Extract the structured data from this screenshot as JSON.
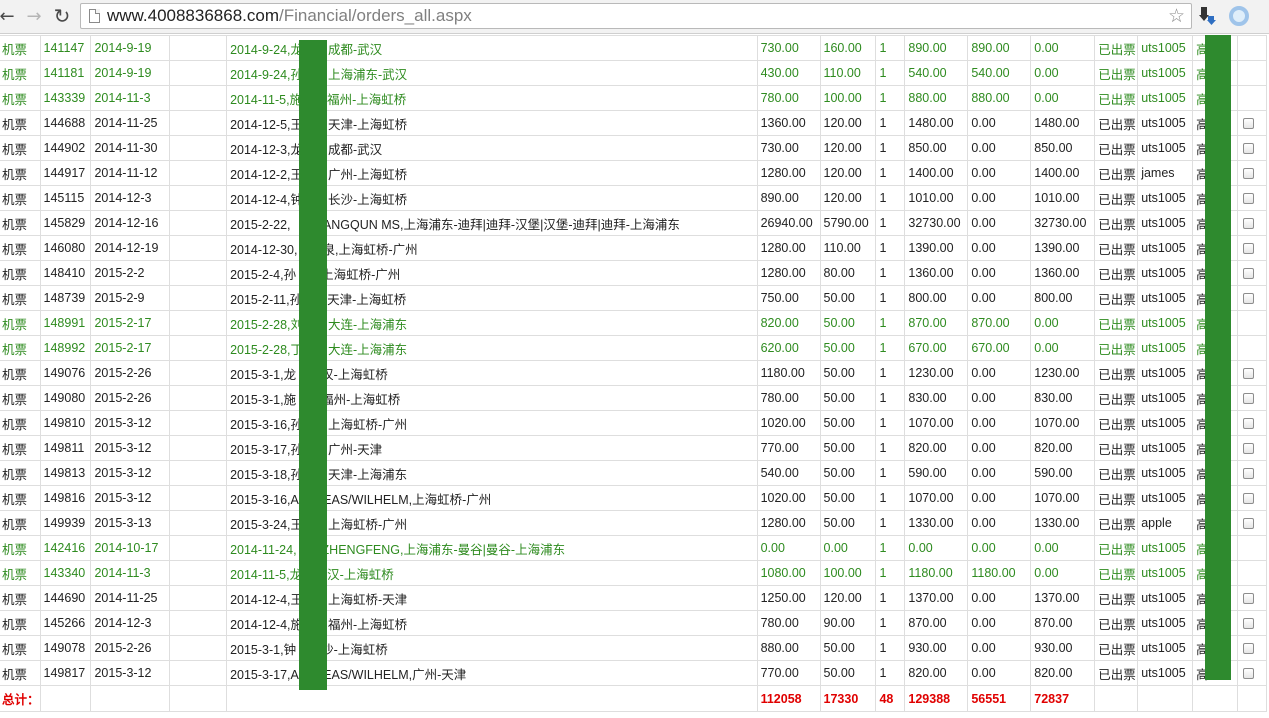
{
  "browser": {
    "url_host": "www.4008836868.com",
    "url_path": "/Financial/orders_all.aspx",
    "back_icon": "back-arrow-icon",
    "forward_icon": "forward-arrow-icon",
    "reload_icon": "reload-icon",
    "bookmark_icon": "star-icon"
  },
  "colors": {
    "issued_green": "#2e8b1f",
    "totals_red": "#e00000",
    "redaction_green": "#2e8a2e"
  },
  "orders": [
    {
      "type": "机票",
      "id": "141147",
      "date": "2014-9-19",
      "detail": "2014-9-24,龙　　成都-武汉",
      "price": "730.00",
      "tax": "160.00",
      "qty": "1",
      "total": "890.00",
      "paid": "890.00",
      "owed": "0.00",
      "status": "已出票",
      "user": "uts1005",
      "tail": "高",
      "green": true,
      "checkbox": false
    },
    {
      "type": "机票",
      "id": "141181",
      "date": "2014-9-19",
      "detail": "2014-9-24,孙　　上海浦东-武汉",
      "price": "430.00",
      "tax": "110.00",
      "qty": "1",
      "total": "540.00",
      "paid": "540.00",
      "owed": "0.00",
      "status": "已出票",
      "user": "uts1005",
      "tail": "高",
      "green": true,
      "checkbox": false
    },
    {
      "type": "机票",
      "id": "143339",
      "date": "2014-11-3",
      "detail": "2014-11-5,施　　福州-上海虹桥",
      "price": "780.00",
      "tax": "100.00",
      "qty": "1",
      "total": "880.00",
      "paid": "880.00",
      "owed": "0.00",
      "status": "已出票",
      "user": "uts1005",
      "tail": "高",
      "green": true,
      "checkbox": false
    },
    {
      "type": "机票",
      "id": "144688",
      "date": "2014-11-25",
      "detail": "2014-12-5,王　　天津-上海虹桥",
      "price": "1360.00",
      "tax": "120.00",
      "qty": "1",
      "total": "1480.00",
      "paid": "0.00",
      "owed": "1480.00",
      "status": "已出票",
      "user": "uts1005",
      "tail": "高",
      "green": false,
      "checkbox": true
    },
    {
      "type": "机票",
      "id": "144902",
      "date": "2014-11-30",
      "detail": "2014-12-3,龙　　成都-武汉",
      "price": "730.00",
      "tax": "120.00",
      "qty": "1",
      "total": "850.00",
      "paid": "0.00",
      "owed": "850.00",
      "status": "已出票",
      "user": "uts1005",
      "tail": "高",
      "green": false,
      "checkbox": true
    },
    {
      "type": "机票",
      "id": "144917",
      "date": "2014-11-12",
      "detail": "2014-12-2,王　　广州-上海虹桥",
      "price": "1280.00",
      "tax": "120.00",
      "qty": "1",
      "total": "1400.00",
      "paid": "0.00",
      "owed": "1400.00",
      "status": "已出票",
      "user": "james",
      "tail": "高",
      "green": false,
      "checkbox": true
    },
    {
      "type": "机票",
      "id": "145115",
      "date": "2014-12-3",
      "detail": "2014-12-4,钟　　长沙-上海虹桥",
      "price": "890.00",
      "tax": "120.00",
      "qty": "1",
      "total": "1010.00",
      "paid": "0.00",
      "owed": "1010.00",
      "status": "已出票",
      "user": "uts1005",
      "tail": "高",
      "green": false,
      "checkbox": true
    },
    {
      "type": "机票",
      "id": "145829",
      "date": "2014-12-16",
      "detail": "2015-2-22,　　YANGQUN MS,上海浦东-迪拜|迪拜-汉堡|汉堡-迪拜|迪拜-上海浦东",
      "price": "26940.00",
      "tax": "5790.00",
      "qty": "1",
      "total": "32730.00",
      "paid": "0.00",
      "owed": "32730.00",
      "status": "已出票",
      "user": "uts1005",
      "tail": "高",
      "green": false,
      "checkbox": true
    },
    {
      "type": "机票",
      "id": "146080",
      "date": "2014-12-19",
      "detail": "2014-12-30,　　泉,上海虹桥-广州",
      "price": "1280.00",
      "tax": "110.00",
      "qty": "1",
      "total": "1390.00",
      "paid": "0.00",
      "owed": "1390.00",
      "status": "已出票",
      "user": "uts1005",
      "tail": "高",
      "green": false,
      "checkbox": true
    },
    {
      "type": "机票",
      "id": "148410",
      "date": "2015-2-2",
      "detail": "2015-2-4,孙　　上海虹桥-广州",
      "price": "1280.00",
      "tax": "80.00",
      "qty": "1",
      "total": "1360.00",
      "paid": "0.00",
      "owed": "1360.00",
      "status": "已出票",
      "user": "uts1005",
      "tail": "高",
      "green": false,
      "checkbox": true
    },
    {
      "type": "机票",
      "id": "148739",
      "date": "2015-2-9",
      "detail": "2015-2-11,孙　　天津-上海虹桥",
      "price": "750.00",
      "tax": "50.00",
      "qty": "1",
      "total": "800.00",
      "paid": "0.00",
      "owed": "800.00",
      "status": "已出票",
      "user": "uts1005",
      "tail": "高",
      "green": false,
      "checkbox": true
    },
    {
      "type": "机票",
      "id": "148991",
      "date": "2015-2-17",
      "detail": "2015-2-28,刘　　大连-上海浦东",
      "price": "820.00",
      "tax": "50.00",
      "qty": "1",
      "total": "870.00",
      "paid": "870.00",
      "owed": "0.00",
      "status": "已出票",
      "user": "uts1005",
      "tail": "高",
      "green": true,
      "checkbox": false
    },
    {
      "type": "机票",
      "id": "148992",
      "date": "2015-2-17",
      "detail": "2015-2-28,丁　　大连-上海浦东",
      "price": "620.00",
      "tax": "50.00",
      "qty": "1",
      "total": "670.00",
      "paid": "670.00",
      "owed": "0.00",
      "status": "已出票",
      "user": "uts1005",
      "tail": "高",
      "green": true,
      "checkbox": false
    },
    {
      "type": "机票",
      "id": "149076",
      "date": "2015-2-26",
      "detail": "2015-3-1,龙　　汉-上海虹桥",
      "price": "1180.00",
      "tax": "50.00",
      "qty": "1",
      "total": "1230.00",
      "paid": "0.00",
      "owed": "1230.00",
      "status": "已出票",
      "user": "uts1005",
      "tail": "高",
      "green": false,
      "checkbox": true
    },
    {
      "type": "机票",
      "id": "149080",
      "date": "2015-2-26",
      "detail": "2015-3-1,施　　福州-上海虹桥",
      "price": "780.00",
      "tax": "50.00",
      "qty": "1",
      "total": "830.00",
      "paid": "0.00",
      "owed": "830.00",
      "status": "已出票",
      "user": "uts1005",
      "tail": "高",
      "green": false,
      "checkbox": true
    },
    {
      "type": "机票",
      "id": "149810",
      "date": "2015-3-12",
      "detail": "2015-3-16,孙　　上海虹桥-广州",
      "price": "1020.00",
      "tax": "50.00",
      "qty": "1",
      "total": "1070.00",
      "paid": "0.00",
      "owed": "1070.00",
      "status": "已出票",
      "user": "uts1005",
      "tail": "高",
      "green": false,
      "checkbox": true
    },
    {
      "type": "机票",
      "id": "149811",
      "date": "2015-3-12",
      "detail": "2015-3-17,孙　　广州-天津",
      "price": "770.00",
      "tax": "50.00",
      "qty": "1",
      "total": "820.00",
      "paid": "0.00",
      "owed": "820.00",
      "status": "已出票",
      "user": "uts1005",
      "tail": "高",
      "green": false,
      "checkbox": true
    },
    {
      "type": "机票",
      "id": "149813",
      "date": "2015-3-12",
      "detail": "2015-3-18,孙　　天津-上海浦东",
      "price": "540.00",
      "tax": "50.00",
      "qty": "1",
      "total": "590.00",
      "paid": "0.00",
      "owed": "590.00",
      "status": "已出票",
      "user": "uts1005",
      "tail": "高",
      "green": false,
      "checkbox": true
    },
    {
      "type": "机票",
      "id": "149816",
      "date": "2015-3-12",
      "detail": "2015-3-16,A　　EAS/WILHELM,上海虹桥-广州",
      "price": "1020.00",
      "tax": "50.00",
      "qty": "1",
      "total": "1070.00",
      "paid": "0.00",
      "owed": "1070.00",
      "status": "已出票",
      "user": "uts1005",
      "tail": "高",
      "green": false,
      "checkbox": true
    },
    {
      "type": "机票",
      "id": "149939",
      "date": "2015-3-13",
      "detail": "2015-3-24,王　　上海虹桥-广州",
      "price": "1280.00",
      "tax": "50.00",
      "qty": "1",
      "total": "1330.00",
      "paid": "0.00",
      "owed": "1330.00",
      "status": "已出票",
      "user": "apple",
      "tail": "高",
      "green": false,
      "checkbox": true
    },
    {
      "type": "机票",
      "id": "142416",
      "date": "2014-10-17",
      "detail": "2014-11-24,　　ZHENGFENG,上海浦东-曼谷|曼谷-上海浦东",
      "price": "0.00",
      "tax": "0.00",
      "qty": "1",
      "total": "0.00",
      "paid": "0.00",
      "owed": "0.00",
      "status": "已出票",
      "user": "uts1005",
      "tail": "高",
      "green": true,
      "checkbox": false
    },
    {
      "type": "机票",
      "id": "143340",
      "date": "2014-11-3",
      "detail": "2014-11-5,龙　　汉-上海虹桥",
      "price": "1080.00",
      "tax": "100.00",
      "qty": "1",
      "total": "1180.00",
      "paid": "1180.00",
      "owed": "0.00",
      "status": "已出票",
      "user": "uts1005",
      "tail": "高",
      "green": true,
      "checkbox": false
    },
    {
      "type": "机票",
      "id": "144690",
      "date": "2014-11-25",
      "detail": "2014-12-4,王　　上海虹桥-天津",
      "price": "1250.00",
      "tax": "120.00",
      "qty": "1",
      "total": "1370.00",
      "paid": "0.00",
      "owed": "1370.00",
      "status": "已出票",
      "user": "uts1005",
      "tail": "高",
      "green": false,
      "checkbox": true
    },
    {
      "type": "机票",
      "id": "145266",
      "date": "2014-12-3",
      "detail": "2014-12-4,施　　福州-上海虹桥",
      "price": "780.00",
      "tax": "90.00",
      "qty": "1",
      "total": "870.00",
      "paid": "0.00",
      "owed": "870.00",
      "status": "已出票",
      "user": "uts1005",
      "tail": "高",
      "green": false,
      "checkbox": true
    },
    {
      "type": "机票",
      "id": "149078",
      "date": "2015-2-26",
      "detail": "2015-3-1,钟　　沙-上海虹桥",
      "price": "880.00",
      "tax": "50.00",
      "qty": "1",
      "total": "930.00",
      "paid": "0.00",
      "owed": "930.00",
      "status": "已出票",
      "user": "uts1005",
      "tail": "高",
      "green": false,
      "checkbox": true
    },
    {
      "type": "机票",
      "id": "149817",
      "date": "2015-3-12",
      "detail": "2015-3-17,A　　EAS/WILHELM,广州-天津",
      "price": "770.00",
      "tax": "50.00",
      "qty": "1",
      "total": "820.00",
      "paid": "0.00",
      "owed": "820.00",
      "status": "已出票",
      "user": "uts1005",
      "tail": "高",
      "green": false,
      "checkbox": true
    }
  ],
  "totals": {
    "label": "总计：",
    "price": "112058",
    "tax": "17330",
    "qty": "48",
    "total": "129388",
    "paid": "56551",
    "owed": "72837"
  }
}
